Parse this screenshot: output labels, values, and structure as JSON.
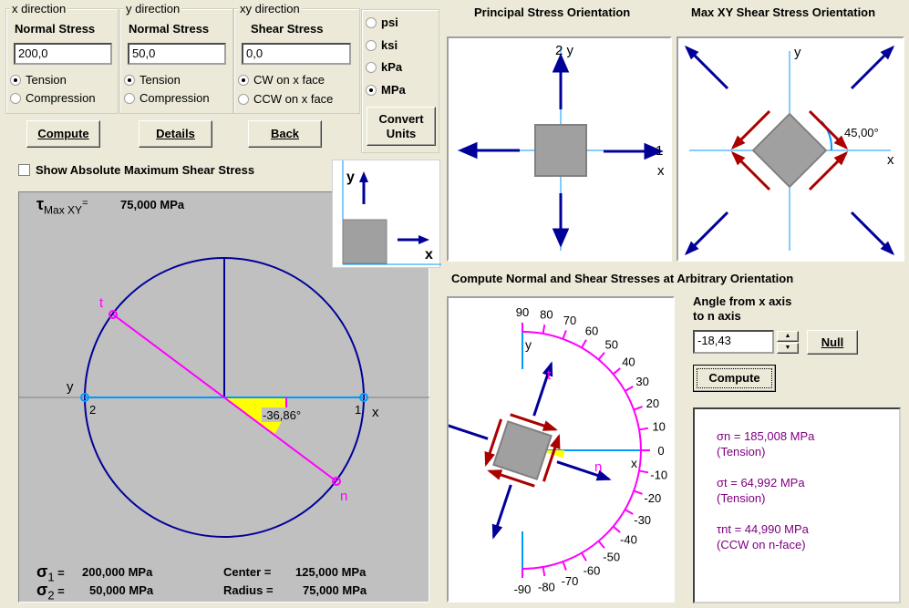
{
  "inputs": {
    "x": {
      "group": "x direction",
      "label": "Normal Stress",
      "value": "200,0",
      "opt1": "Tension",
      "opt2": "Compression",
      "selected": "Tension"
    },
    "y": {
      "group": "y direction",
      "label": "Normal Stress",
      "value": "50,0",
      "opt1": "Tension",
      "opt2": "Compression",
      "selected": "Tension"
    },
    "xy": {
      "group": "xy direction",
      "label": "Shear Stress",
      "value": "0,0",
      "opt1": "CW on x face",
      "opt2": "CCW on x face",
      "selected": "CW on x face"
    }
  },
  "units": {
    "options": [
      "psi",
      "ksi",
      "kPa",
      "MPa"
    ],
    "selected": "MPa",
    "convert_label": "Convert Units"
  },
  "buttons": {
    "compute": "Compute",
    "details": "Details",
    "back": "Back"
  },
  "show_abs_max": {
    "label": "Show Absolute Maximum Shear Stress",
    "checked": false
  },
  "inset": {
    "y": "y",
    "x": "x"
  },
  "mohr": {
    "tau_label": "τ",
    "tau_sub": "Max XY",
    "tau_eq": "=",
    "tau_value": "75,000 MPa",
    "sigma1_label": "σ",
    "sigma1_sub": "1",
    "sigma1_value": "200,000 MPa",
    "sigma2_label": "σ",
    "sigma2_sub": "2",
    "sigma2_value": "50,000 MPa",
    "center_label": "Center =",
    "center_value": "125,000 MPa",
    "radius_label": "Radius =",
    "radius_value": "75,000 MPa",
    "angle": "-36,86°",
    "pt_t": "t",
    "pt_n": "n",
    "pt_1": "1",
    "pt_2": "2",
    "ax_x": "x",
    "ax_y": "y",
    "colors": {
      "circle": "#000099",
      "axis": "#0099FF",
      "nt": "#FF00FF",
      "wedge": "#FFFF00",
      "bg": "#C0C0C0"
    }
  },
  "principal": {
    "title": "Principal Stress Orientation",
    "lbl_top": "2 y",
    "lbl_right": "1",
    "lbl_x": "x"
  },
  "maxshear": {
    "title": "Max XY Shear Stress Orientation",
    "lbl_y": "y",
    "lbl_x": "x",
    "angle": "45,00°"
  },
  "arbitrary": {
    "title": "Compute Normal and Shear Stresses at Arbitrary Orientation",
    "angle_label1": "Angle from x axis",
    "angle_label2": "to n axis",
    "angle_value": "-18,43",
    "null_label": "Null",
    "compute_label": "Compute",
    "ticks": [
      90,
      80,
      70,
      60,
      50,
      40,
      30,
      20,
      10,
      0,
      -10,
      -20,
      -30,
      -40,
      -50,
      -60,
      -70,
      -80,
      -90
    ],
    "lbl_t": "t",
    "lbl_n": "n",
    "lbl_x": "x",
    "lbl_y": "y",
    "angle_deg": -18.43
  },
  "results": {
    "sn": "σn = 185,008 MPa",
    "sn_note": "(Tension)",
    "st": "σt = 64,992 MPa",
    "st_note": "(Tension)",
    "tnt": "τnt = 44,990 MPa",
    "tnt_note": "(CCW on n-face)",
    "color": "#800080"
  }
}
